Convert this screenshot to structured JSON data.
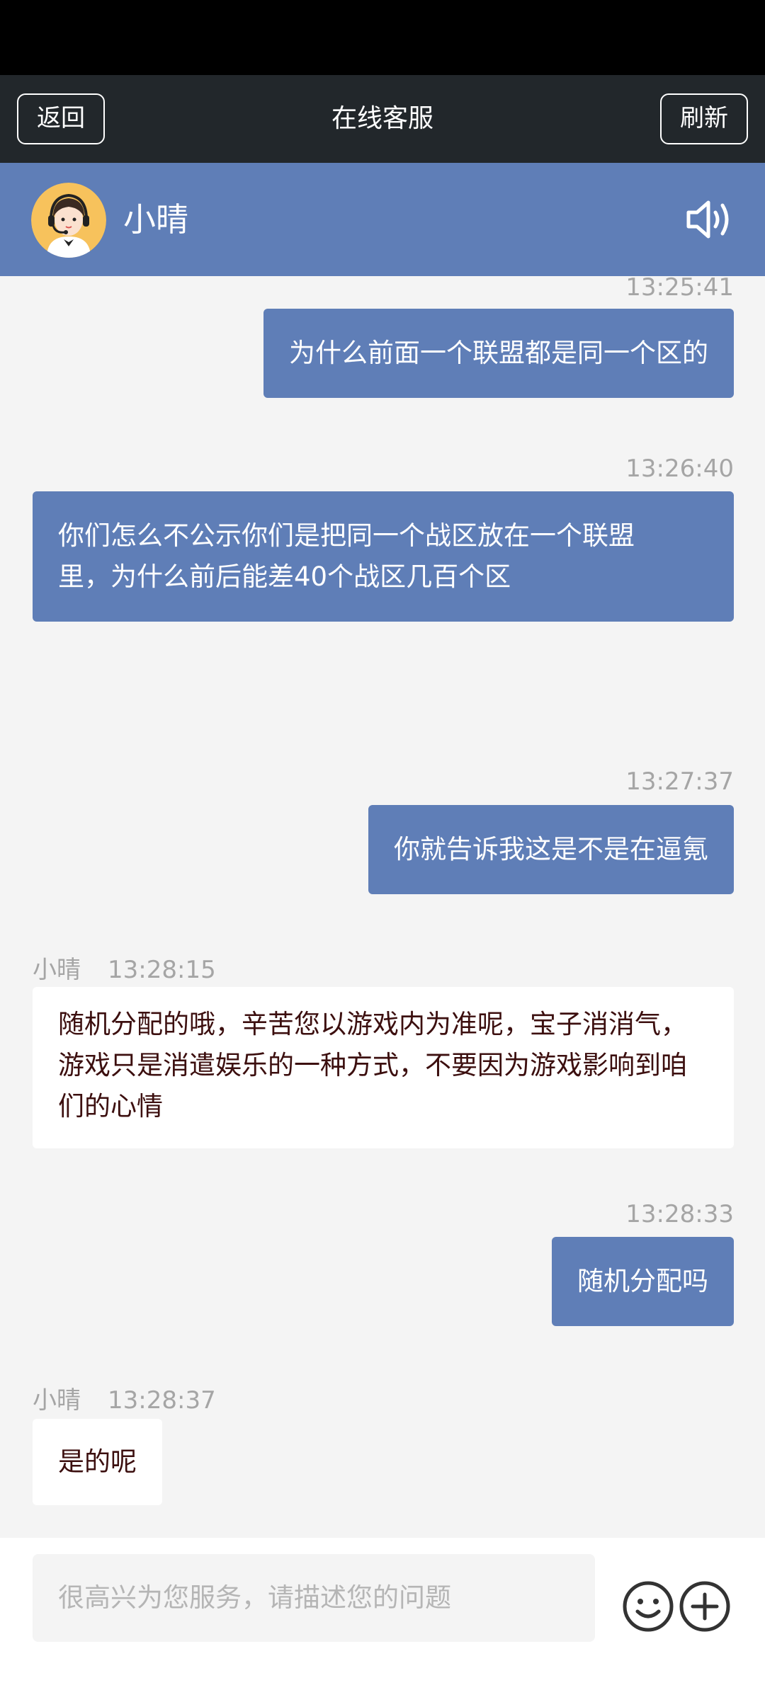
{
  "header": {
    "back_label": "返回",
    "title": "在线客服",
    "refresh_label": "刷新"
  },
  "agent": {
    "name": "小晴",
    "avatar_icon": "customer-service-avatar-icon",
    "speaker_icon": "speaker-icon"
  },
  "messages": [
    {
      "from": "me",
      "time": "13:25:41",
      "text": "为什么前面一个联盟都是同一个区的"
    },
    {
      "from": "me",
      "time": "13:26:40",
      "lines": [
        "你们怎么不公示你们是把同一个战区放在一个联盟",
        "里，为什么前后能差40个战区几百个区"
      ]
    },
    {
      "from": "me",
      "time": "13:27:37",
      "text": "你就告诉我这是不是在逼氪"
    },
    {
      "from": "agent",
      "name": "小晴",
      "time": "13:28:15",
      "lines": [
        "随机分配的哦，辛苦您以游戏内为准呢，宝子消消气，",
        "游戏只是消遣娱乐的一种方式，不要因为游戏影响到咱",
        "们的心情"
      ]
    },
    {
      "from": "me",
      "time": "13:28:33",
      "text": "随机分配吗"
    },
    {
      "from": "agent",
      "name": "小晴",
      "time": "13:28:37",
      "text": "是的呢"
    }
  ],
  "input": {
    "placeholder": "很高兴为您服务，请描述您的问题",
    "emoji_icon": "emoji-icon",
    "plus_icon": "plus-icon"
  },
  "colors": {
    "accent": "#5f7eb7",
    "topbar": "#22272b",
    "background": "#f4f4f4"
  }
}
